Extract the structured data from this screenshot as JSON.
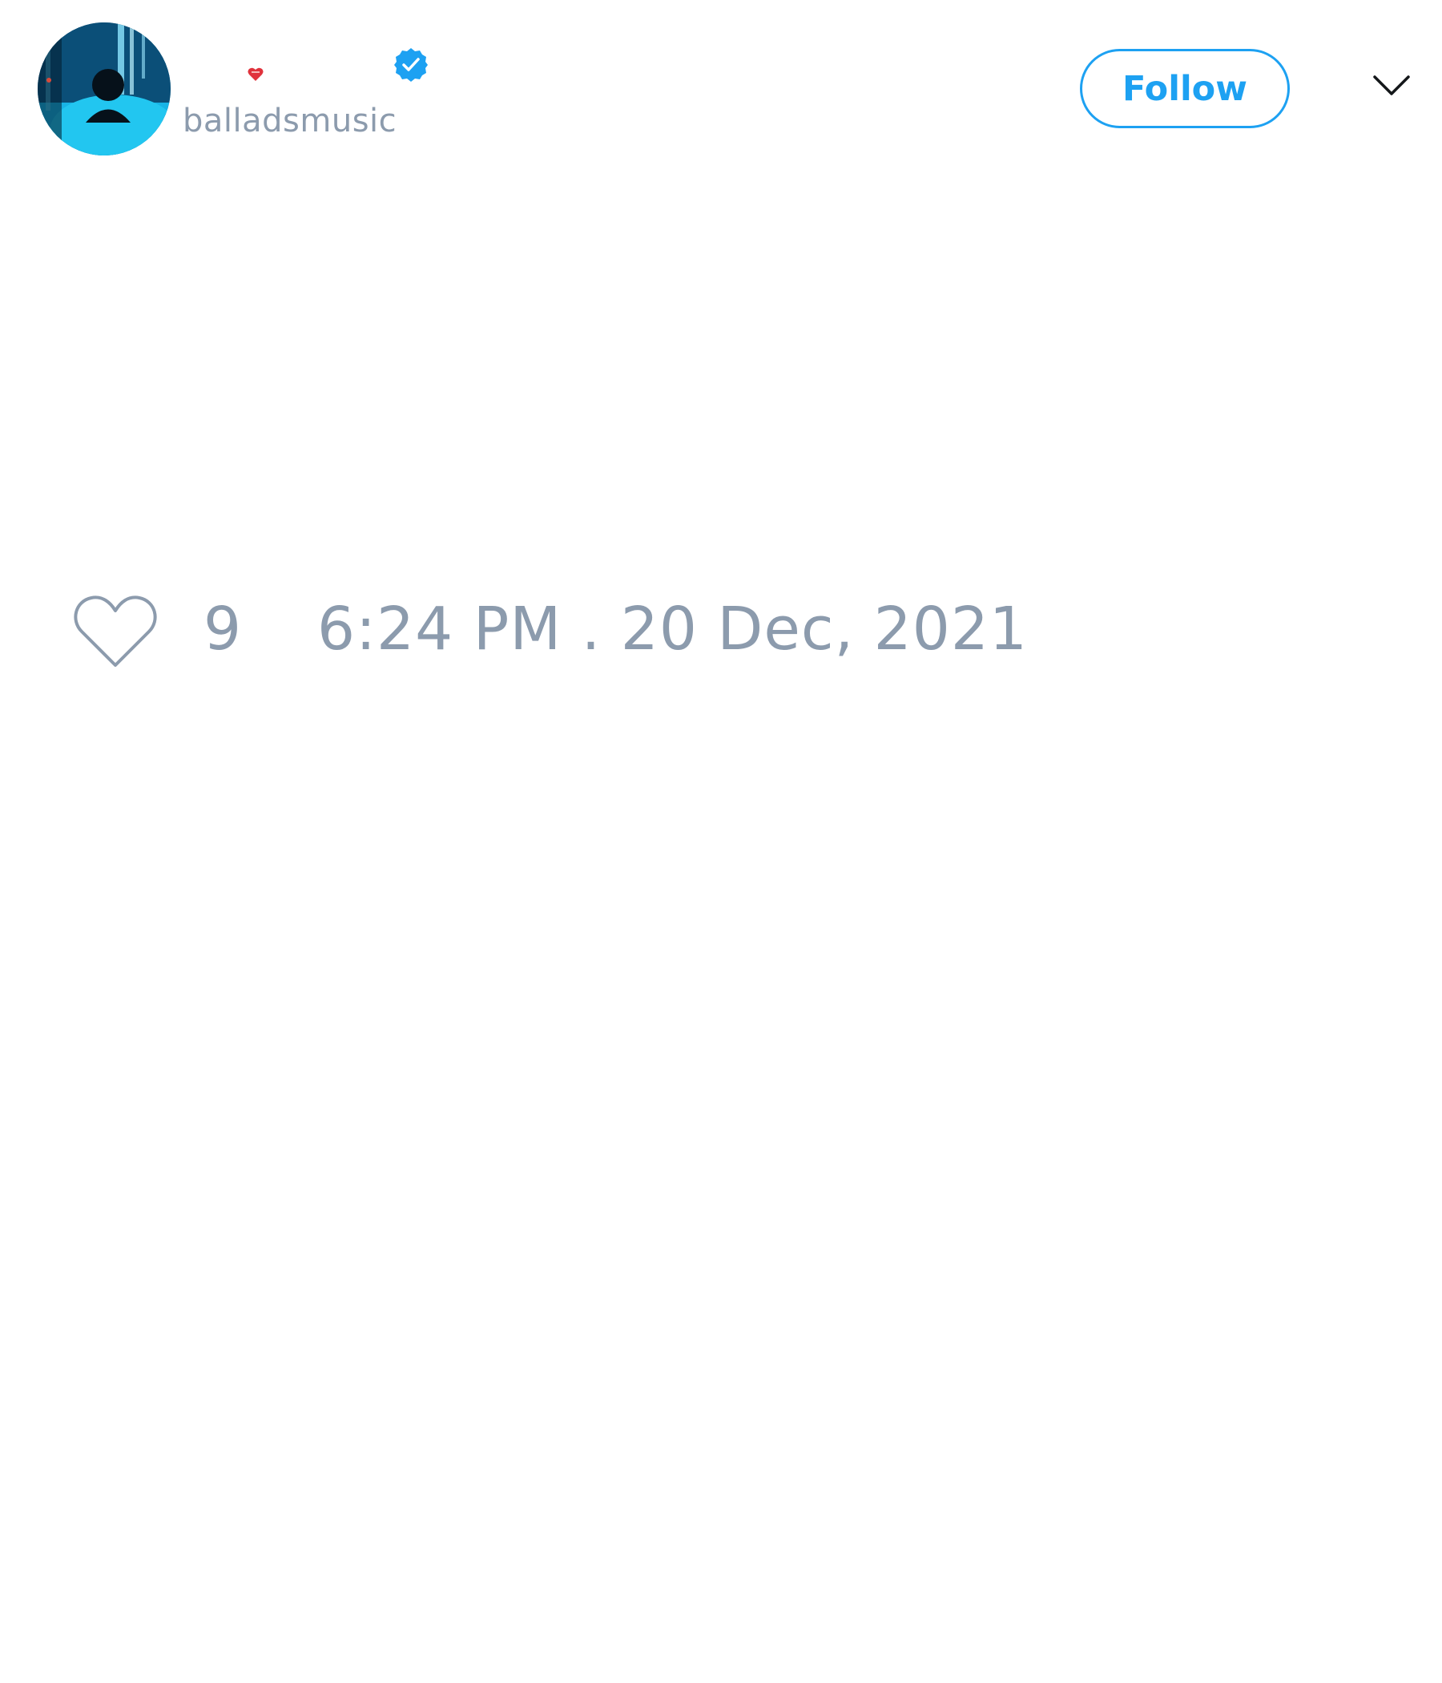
{
  "tweet": {
    "author": {
      "display_name": "",
      "handle": "balladsmusic",
      "verified": true,
      "avatar_icon": "profile-avatar-photo",
      "name_emoji_icon": "red-heart-icon"
    },
    "follow_label": "Follow",
    "menu_icon": "chevron-down-icon",
    "likes": {
      "icon": "heart-outline-icon",
      "count": "9"
    },
    "timestamp": "6:24 PM . 20 Dec, 2021"
  },
  "colors": {
    "accent": "#1da1f2",
    "muted_text": "#8c9bad",
    "emoji_red": "#e0323c"
  }
}
